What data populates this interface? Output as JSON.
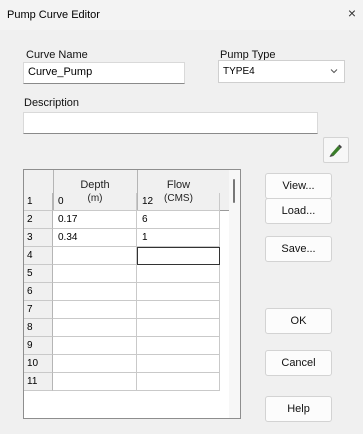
{
  "window": {
    "title": "Pump Curve Editor",
    "close_glyph": "×"
  },
  "form": {
    "curve_name_label": "Curve Name",
    "curve_name_value": "Curve_Pump",
    "pump_type_label": "Pump Type",
    "pump_type_value": "TYPE4",
    "description_label": "Description",
    "description_value": "",
    "edit_icon": "pencil-edit-icon"
  },
  "grid": {
    "columns": [
      {
        "line1": "Depth",
        "line2": "(m)"
      },
      {
        "line1": "Flow",
        "line2": "(CMS)"
      }
    ],
    "rows": [
      {
        "num": "1",
        "depth": "0",
        "flow": "12"
      },
      {
        "num": "2",
        "depth": "0.17",
        "flow": "6"
      },
      {
        "num": "3",
        "depth": "0.34",
        "flow": "1"
      },
      {
        "num": "4",
        "depth": "",
        "flow": ""
      },
      {
        "num": "5",
        "depth": "",
        "flow": ""
      },
      {
        "num": "6",
        "depth": "",
        "flow": ""
      },
      {
        "num": "7",
        "depth": "",
        "flow": ""
      },
      {
        "num": "8",
        "depth": "",
        "flow": ""
      },
      {
        "num": "9",
        "depth": "",
        "flow": ""
      },
      {
        "num": "10",
        "depth": "",
        "flow": ""
      },
      {
        "num": "11",
        "depth": "",
        "flow": ""
      }
    ]
  },
  "buttons": {
    "view": "View...",
    "load": "Load...",
    "save": "Save...",
    "ok": "OK",
    "cancel": "Cancel",
    "help": "Help"
  },
  "colors": {
    "edit_icon_green": "#3a7d2a",
    "edit_icon_dark": "#444444"
  }
}
